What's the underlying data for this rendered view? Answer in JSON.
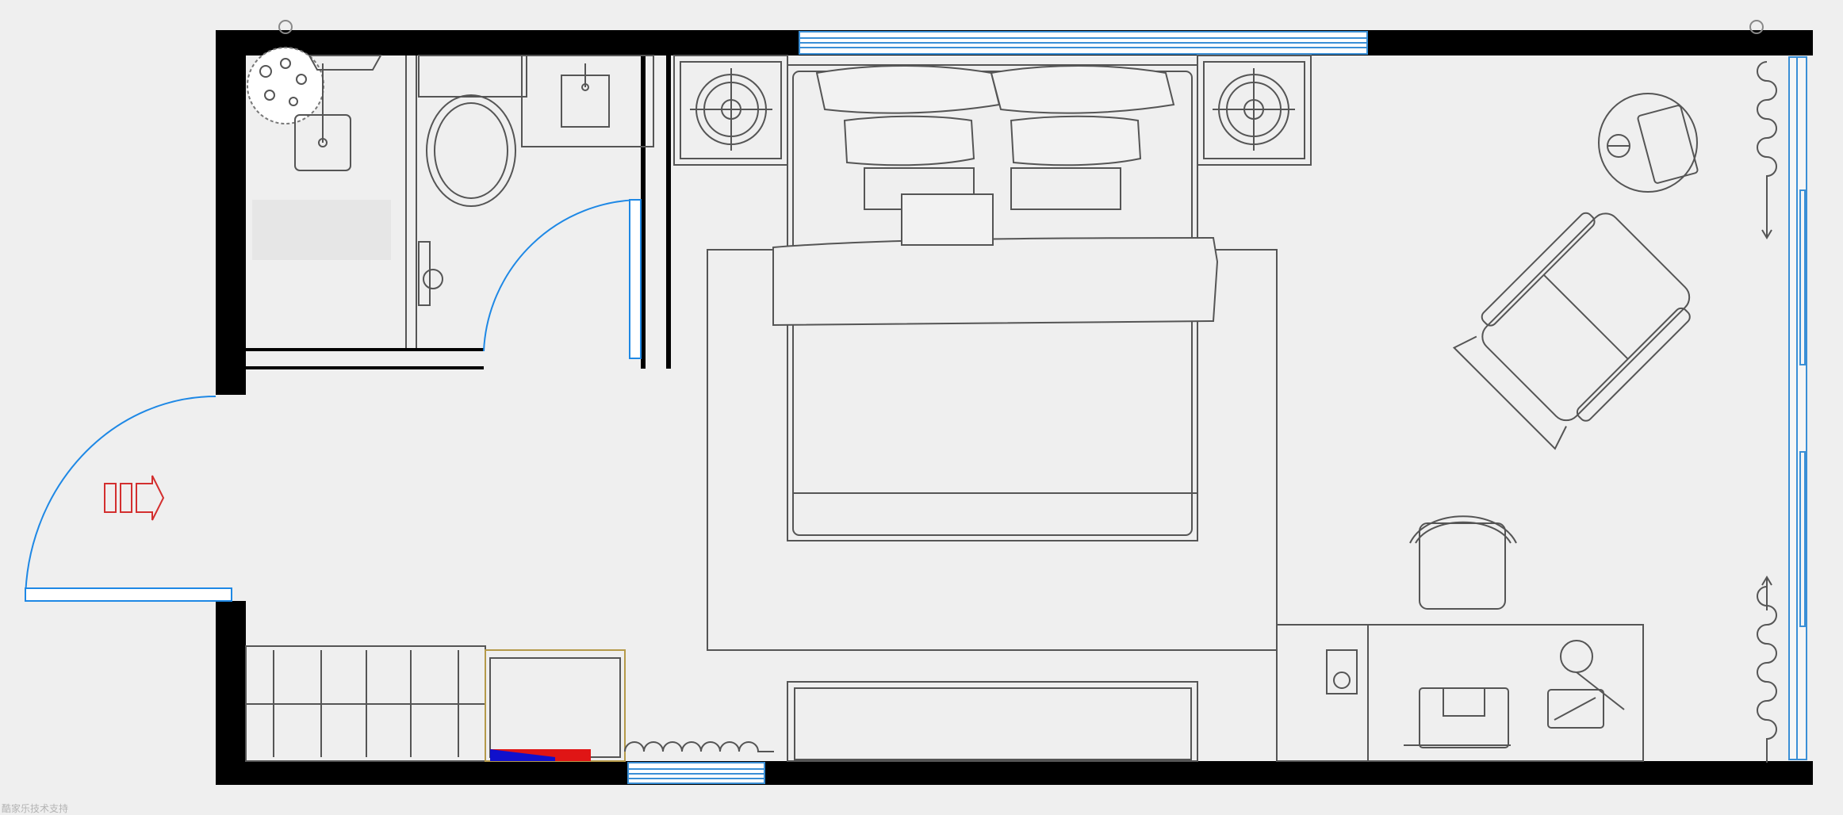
{
  "plan": {
    "entrance_marker": "入口",
    "footer_watermark": "酷家乐技术支持"
  },
  "rooms": [
    "bathroom",
    "bedroom"
  ],
  "colors": {
    "background": "#efefef",
    "wall": "#000000",
    "line": "#555555",
    "window_glass": "#3a8fd6",
    "door_swing": "#1e88e5",
    "entrance_arrow": "#d32f2f",
    "cabinet_outline": "#b59a4a",
    "accent_red": "#e01515",
    "accent_blue": "#1010cc"
  },
  "icons": [
    "entrance-arrow-icon",
    "sink-icon",
    "toilet-icon",
    "shower-icon",
    "bed-icon",
    "pillow-icon",
    "nightstand-lamp-icon",
    "armchair-icon",
    "side-table-icon",
    "desk-chair-icon",
    "curtain-icon",
    "rug-icon",
    "wardrobe-icon",
    "safe-icon",
    "tv-cabinet-icon",
    "desk-lamp-icon"
  ]
}
